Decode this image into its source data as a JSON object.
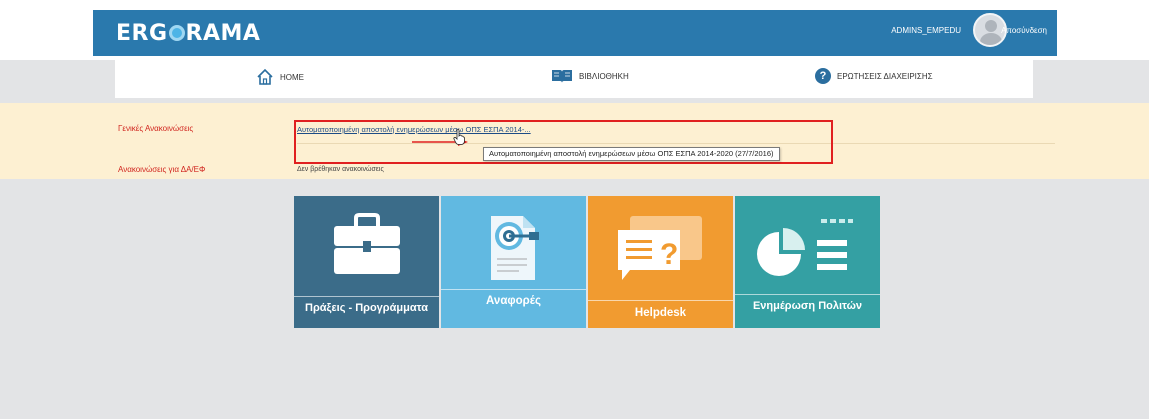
{
  "header": {
    "logo_left": "ERG",
    "logo_right": "RAMA",
    "user": "ADMINS_EMPEDU",
    "logout": "Αποσύνδεση"
  },
  "nav": {
    "home": "HOME",
    "library": "ΒΙΒΛΙΟΘΗΚΗ",
    "faq": "ΕΡΩΤΗΣΕΙΣ ΔΙΑΧΕΙΡΙΣΗΣ"
  },
  "announcements": {
    "general_label": "Γενικές Ανακοινώσεις",
    "general_link": "Αυτοματοποιημένη αποστολή ενημερώσεων μέσω ΟΠΣ ΕΣΠΑ 2014-...",
    "tooltip": "Αυτοματοποιημένη αποστολή ενημερώσεων μέσω ΟΠΣ ΕΣΠΑ 2014-2020 (27/7/2016)",
    "agency_label": "Ανακοινώσεις για ΔΑ/ΕΦ",
    "agency_none": "Δεν βρέθηκαν ανακοινώσεις"
  },
  "tiles": {
    "t1": "Πράξεις - Προγράμματα",
    "t2": "Αναφορές",
    "t3": "Helpdesk",
    "t4": "Ενημέρωση Πολιτών"
  },
  "colors": {
    "header_blue": "#2a79ad",
    "announcement_bg": "#fdf0d2",
    "label_red": "#d1261f",
    "tile_projects": "#3b6c89",
    "tile_reports": "#61b9e1",
    "tile_helpdesk": "#f19b30",
    "tile_citizens": "#34a0a3"
  },
  "icons": [
    "home-icon",
    "book-icon",
    "question-icon",
    "briefcase-icon",
    "target-document-icon",
    "chat-question-icon",
    "pie-chart-icon"
  ]
}
